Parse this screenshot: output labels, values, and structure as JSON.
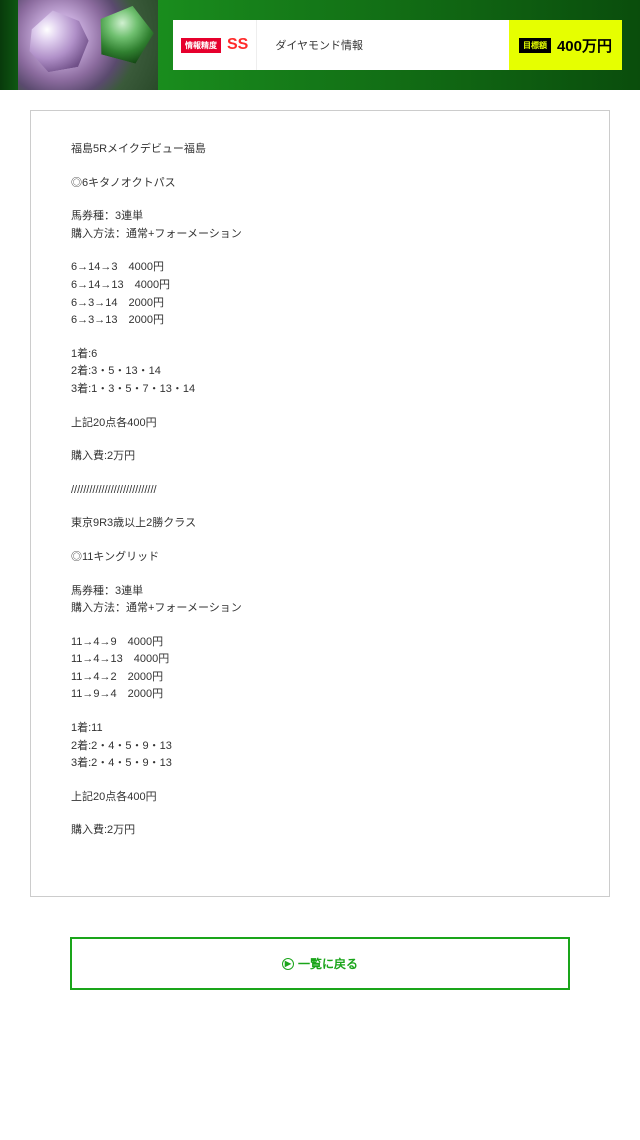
{
  "hero": {
    "badge_accuracy_label": "情報精度",
    "grade": "SS",
    "title": "ダイヤモンド情報",
    "target_label": "目標額",
    "target_amount": "400万円"
  },
  "content": {
    "race1_title": "福島5Rメイクデビュー福島",
    "race1_pick": "◎6キタノオクトパス",
    "race1_type": "馬券種：3連単\n購入方法：通常+フォーメーション",
    "race1_bets": "6→14→3　4000円\n6→14→13　4000円\n6→3→14　2000円\n6→3→13　2000円",
    "race1_placings": "1着:6\n2着:3・5・13・14\n3着:1・3・5・7・13・14",
    "race1_summary": "上記20点各400円",
    "race1_cost": "購入費:2万円",
    "divider": "////////////////////////////",
    "race2_title": "東京9R3歳以上2勝クラス",
    "race2_pick": "◎11キングリッド",
    "race2_type": "馬券種：3連単\n購入方法：通常+フォーメーション",
    "race2_bets": "11→4→9　4000円\n11→4→13　4000円\n11→4→2　2000円\n11→9→4　2000円",
    "race2_placings": "1着:11\n2着:2・4・5・9・13\n3着:2・4・5・9・13",
    "race2_summary": "上記20点各400円",
    "race2_cost": "購入費:2万円"
  },
  "back_button": "一覧に戻る"
}
